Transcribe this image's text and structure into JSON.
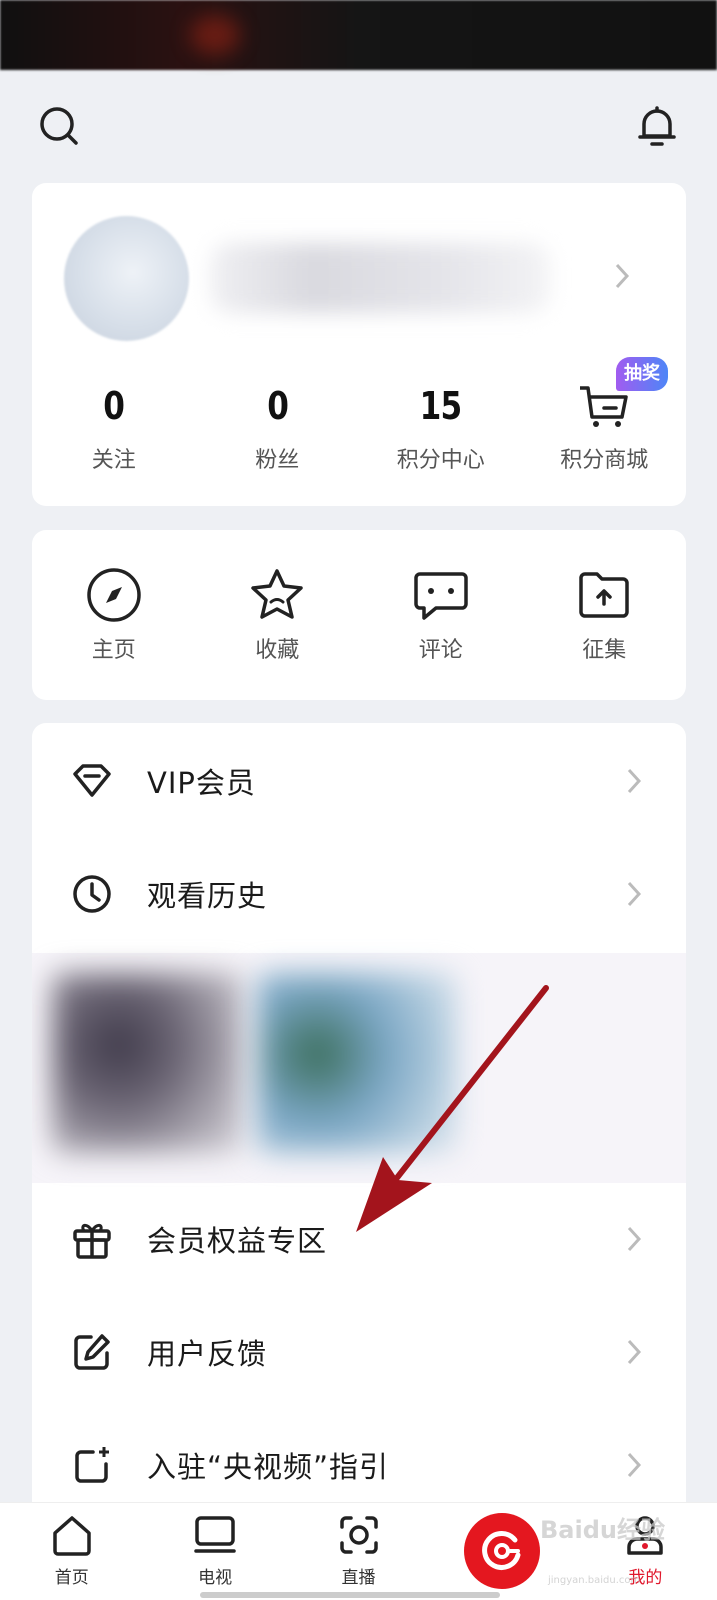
{
  "header": {
    "search_icon": "search-icon",
    "notification_icon": "bell-icon"
  },
  "profile": {
    "stats": [
      {
        "value": "0",
        "label": "关注"
      },
      {
        "value": "0",
        "label": "粉丝"
      },
      {
        "value": "15",
        "label": "积分中心"
      },
      {
        "icon": "cart-icon",
        "label": "积分商城",
        "badge": "抽奖"
      }
    ]
  },
  "shortcuts": [
    {
      "icon": "compass-icon",
      "label": "主页"
    },
    {
      "icon": "star-icon",
      "label": "收藏"
    },
    {
      "icon": "comment-icon",
      "label": "评论"
    },
    {
      "icon": "folder-upload-icon",
      "label": "征集"
    }
  ],
  "menu": [
    {
      "icon": "diamond-icon",
      "label": "VIP会员"
    },
    {
      "icon": "clock-icon",
      "label": "观看历史"
    },
    {
      "icon": "gift-icon",
      "label": "会员权益专区"
    },
    {
      "icon": "edit-icon",
      "label": "用户反馈"
    },
    {
      "icon": "add-square-icon",
      "label": "入驻“央视频”指引"
    }
  ],
  "bottom_nav": [
    {
      "icon": "home-icon",
      "label": "首页"
    },
    {
      "icon": "tv-icon",
      "label": "电视"
    },
    {
      "icon": "live-icon",
      "label": "直播"
    },
    {
      "icon": "center-logo-icon",
      "label": ""
    },
    {
      "icon": "profile-icon",
      "label": "我的",
      "active": true
    }
  ],
  "watermark": {
    "text": "Baidu经验",
    "sub": "jingyan.baidu.com"
  },
  "colors": {
    "accent": "#e4171f",
    "badge_from": "#a15cf0",
    "badge_to": "#4d86f7",
    "annotation_arrow": "#a3141c"
  }
}
